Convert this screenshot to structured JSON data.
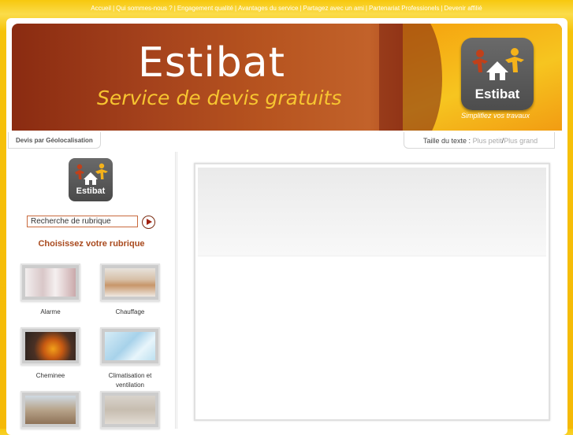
{
  "topnav": {
    "items": [
      "Accueil",
      "Qui sommes-nous ?",
      "Engagement qualité",
      "Avantages du service",
      "Partagez avec un ami",
      "Partenariat Professionels",
      "Devenir affilié"
    ]
  },
  "banner": {
    "title": "Estibat",
    "subtitle": "Service de devis gratuits",
    "logo_text": "Estibat",
    "tagline": "Simplifiez vos travaux"
  },
  "tabs": {
    "left": "Devis par Géolocalisation",
    "text_size_label": "Taille du texte :",
    "smaller": "Plus petit",
    "slash": "/",
    "larger": "Plus grand"
  },
  "sidebar": {
    "logo_text": "Estibat",
    "search_value": "Recherche de rubrique",
    "choose_label": "Choisissez votre rubrique",
    "categories": [
      {
        "label": "Alarme"
      },
      {
        "label": "Chauffage"
      },
      {
        "label": "Cheminee"
      },
      {
        "label": "Climatisation et ventilation"
      },
      {
        "label": ""
      },
      {
        "label": ""
      }
    ]
  },
  "colors": {
    "accent_orange": "#f6c30a",
    "brand_brown": "#a94a1e",
    "search_border": "#c96a3d"
  },
  "icons": {
    "logo": "estibat-house-people-icon",
    "search_button": "play-arrow-icon"
  }
}
